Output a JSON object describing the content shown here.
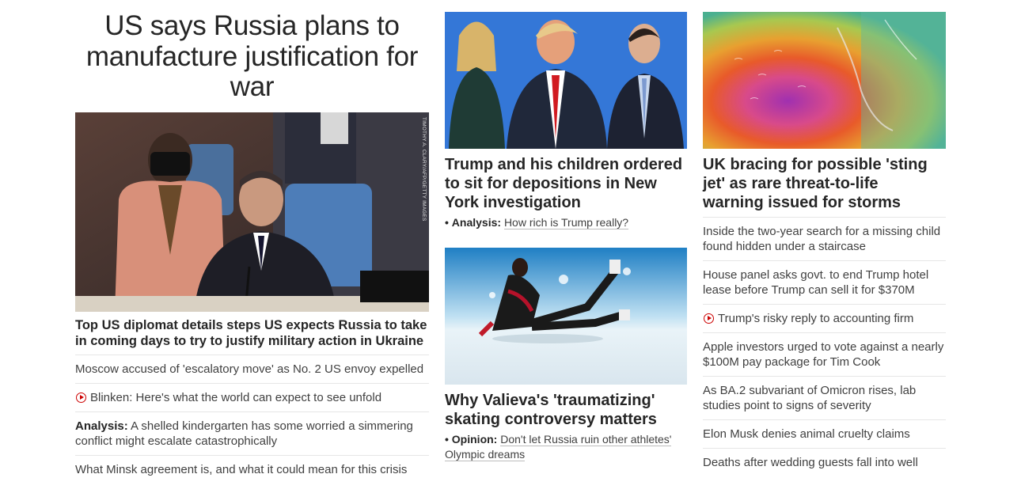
{
  "main": {
    "title": "US says Russia plans to manufacture justification for war",
    "photo_credit": "TIMOTHY A. CLARY/AFP/GETTY IMAGES",
    "lead_story": "Top US diplomat details steps US expects Russia to take in coming days to try to justify military action in Ukraine",
    "related": [
      {
        "kicker": "",
        "text": "Moscow accused of 'escalatory move' as No. 2 US envoy expelled",
        "video": false
      },
      {
        "kicker": "",
        "text": "Blinken: Here's what the world can expect to see unfold",
        "video": true
      },
      {
        "kicker": "Analysis:",
        "text": "A shelled kindergarten has some worried a simmering conflict might escalate catastrophically",
        "video": false
      },
      {
        "kicker": "",
        "text": "What Minsk agreement is, and what it could mean for this crisis",
        "video": false
      }
    ]
  },
  "card_trump": {
    "headline": "Trump and his children ordered to sit for depositions in New York investigation",
    "bullet": "•",
    "kicker": "Analysis:",
    "sub": "How rich is Trump really?"
  },
  "card_valieva": {
    "headline": "Why Valieva's 'traumatizing' skating controversy matters",
    "bullet": "•",
    "kicker": "Opinion:",
    "sub": "Don't let Russia ruin other athletes' Olympic dreams"
  },
  "card_storm": {
    "headline": "UK bracing for possible 'sting jet' as rare threat-to-life warning issued for storms"
  },
  "side_list": [
    {
      "text": "Inside the two-year search for a missing child found hidden under a staircase",
      "video": false
    },
    {
      "text": "House panel asks govt. to end Trump hotel lease before Trump can sell it for $370M",
      "video": false
    },
    {
      "text": "Trump's risky reply to accounting firm",
      "video": true
    },
    {
      "text": "Apple investors urged to vote against a nearly $100M pay package for Tim Cook",
      "video": false
    },
    {
      "text": "As BA.2 subvariant of Omicron rises, lab studies point to signs of severity",
      "video": false
    },
    {
      "text": "Elon Musk denies animal cruelty claims",
      "video": false
    },
    {
      "text": "Deaths after wedding guests fall into well",
      "video": false
    }
  ],
  "colors": {
    "accent": "#cc0000",
    "text": "#262626",
    "divider": "#e6e6e6"
  }
}
